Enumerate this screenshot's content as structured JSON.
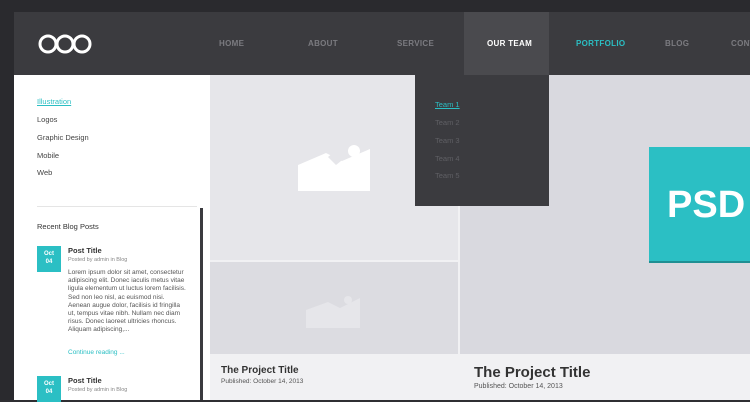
{
  "nav": {
    "items": [
      {
        "label": "HOME"
      },
      {
        "label": "ABOUT"
      },
      {
        "label": "SERVICE"
      },
      {
        "label": "OUR TEAM"
      },
      {
        "label": "PORTFOLIO"
      },
      {
        "label": "BLOG"
      },
      {
        "label": "CONT"
      }
    ]
  },
  "dropdown": {
    "items": [
      "Team 1",
      "Team 2",
      "Team 3",
      "Team 4",
      "Team 5"
    ]
  },
  "sidebar": {
    "categories": [
      "Illustration",
      "Logos",
      "Graphic Design",
      "Mobile",
      "Web"
    ],
    "recent_title": "Recent Blog Posts",
    "posts": [
      {
        "month": "Oct",
        "day": "04",
        "title": "Post Title",
        "meta": "Posted by admin in Blog",
        "excerpt": "Lorem ipsum dolor sit amet, consectetur adipiscing elit. Donec iaculis metus vitae ligula elementum ut luctus lorem facilisis. Sed non leo nisl, ac euismod nisi. Aenean augue dolor, facilisis id fringilla ut, tempus vitae nibh. Nullam nec diam risus. Donec laoreet ultricies rhoncus. Aliquam adipiscing,...",
        "link": "Continue reading ..."
      },
      {
        "month": "Oct",
        "day": "04",
        "title": "Post Title",
        "meta": "Posted by admin in Blog"
      }
    ]
  },
  "projects": [
    {
      "title": "The Project Title",
      "date": "Published: October 14, 2013"
    },
    {
      "title": "The Project Title",
      "date": "Published: October 14, 2013"
    }
  ],
  "psd_label": "PSD",
  "colors": {
    "accent": "#2bbfc4",
    "header": "#3b3b3f"
  }
}
